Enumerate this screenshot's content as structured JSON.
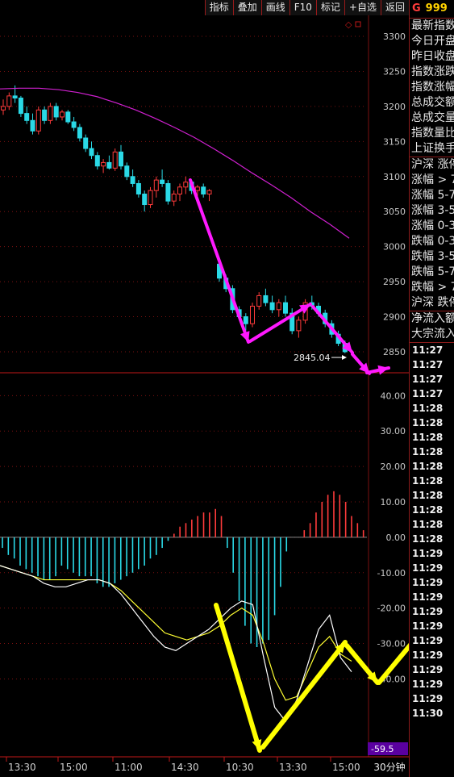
{
  "toolbar": {
    "buttons": [
      "指标",
      "叠加",
      "画线",
      "F10",
      "标记",
      "+自选",
      "返回"
    ]
  },
  "side_panel": {
    "header_g": "G",
    "header_code": "999",
    "rows": [
      "最新指数",
      "今日开盘",
      "昨日收盘",
      "指数涨跌",
      "指数涨幅",
      "总成交额",
      "总成交量",
      "指数量比",
      "上证换手"
    ],
    "breadth_header": "沪深 涨停",
    "breadth_rows": [
      "涨幅 > 7",
      "涨幅 5-7",
      "涨幅 3-5",
      "涨幅 0-3",
      "跌幅 0-3",
      "跌幅 3-5",
      "跌幅 5-7",
      "跌幅 > 7",
      "沪深 跌停"
    ],
    "flow_rows": [
      "净流入额",
      "大宗流入"
    ],
    "times": [
      "11:27",
      "11:27",
      "11:27",
      "11:27",
      "11:28",
      "11:28",
      "11:28",
      "11:28",
      "11:28",
      "11:28",
      "11:28",
      "11:28",
      "11:28",
      "11:28",
      "11:29",
      "11:29",
      "11:29",
      "11:29",
      "11:29",
      "11:29",
      "11:29",
      "11:29",
      "11:29",
      "11:29",
      "11:29",
      "11:30"
    ]
  },
  "timeframe_label": "30分钟",
  "colors": {
    "up": "#ff3b3b",
    "down": "#2ad9e6",
    "ma": "#d020d0",
    "dif": "#ffffff",
    "dea": "#ffff33",
    "grid": "#7a1010",
    "axis_text": "#c8c8c8",
    "arrow_magenta": "#ff19ff",
    "arrow_yellow": "#ffff00",
    "marker_bg": "#5a00a0"
  },
  "chart_data": [
    {
      "type": "candlestick",
      "ylim": [
        2820,
        3330
      ],
      "yticks": [
        2850,
        2900,
        2950,
        3000,
        3050,
        3100,
        3150,
        3200,
        3250,
        3300
      ],
      "candles": [
        [
          3195,
          3210,
          3188,
          3200
        ],
        [
          3200,
          3220,
          3195,
          3215
        ],
        [
          3215,
          3230,
          3205,
          3212
        ],
        [
          3212,
          3215,
          3185,
          3190
        ],
        [
          3190,
          3200,
          3175,
          3180
        ],
        [
          3180,
          3190,
          3160,
          3165
        ],
        [
          3165,
          3200,
          3160,
          3195
        ],
        [
          3195,
          3200,
          3175,
          3180
        ],
        [
          3180,
          3205,
          3175,
          3200
        ],
        [
          3200,
          3205,
          3180,
          3185
        ],
        [
          3185,
          3195,
          3180,
          3192
        ],
        [
          3192,
          3195,
          3175,
          3178
        ],
        [
          3178,
          3185,
          3165,
          3170
        ],
        [
          3170,
          3175,
          3150,
          3155
        ],
        [
          3155,
          3160,
          3135,
          3140
        ],
        [
          3140,
          3150,
          3125,
          3130
        ],
        [
          3130,
          3135,
          3110,
          3115
        ],
        [
          3115,
          3125,
          3105,
          3120
        ],
        [
          3120,
          3130,
          3110,
          3112
        ],
        [
          3112,
          3140,
          3108,
          3135
        ],
        [
          3135,
          3145,
          3110,
          3115
        ],
        [
          3115,
          3120,
          3095,
          3100
        ],
        [
          3100,
          3110,
          3085,
          3090
        ],
        [
          3090,
          3095,
          3070,
          3075
        ],
        [
          3075,
          3080,
          3050,
          3060
        ],
        [
          3060,
          3085,
          3055,
          3080
        ],
        [
          3080,
          3100,
          3070,
          3095
        ],
        [
          3095,
          3110,
          3085,
          3090
        ],
        [
          3090,
          3095,
          3060,
          3065
        ],
        [
          3065,
          3080,
          3058,
          3075
        ],
        [
          3075,
          3090,
          3065,
          3085
        ],
        [
          3085,
          3100,
          3075,
          3092
        ],
        [
          3092,
          3095,
          3075,
          3080
        ],
        [
          3080,
          3088,
          3072,
          3085
        ],
        [
          3085,
          3090,
          3070,
          3075
        ],
        [
          3075,
          3082,
          3065,
          3080
        ],
        [
          2975,
          2980,
          2950,
          2955
        ],
        [
          2955,
          2960,
          2935,
          2940
        ],
        [
          2940,
          2945,
          2905,
          2910
        ],
        [
          2910,
          2915,
          2895,
          2900
        ],
        [
          2900,
          2905,
          2880,
          2890
        ],
        [
          2890,
          2920,
          2885,
          2915
        ],
        [
          2915,
          2935,
          2910,
          2930
        ],
        [
          2930,
          2940,
          2915,
          2920
        ],
        [
          2920,
          2930,
          2905,
          2910
        ],
        [
          2910,
          2925,
          2900,
          2920
        ],
        [
          2920,
          2930,
          2900,
          2905
        ],
        [
          2905,
          2912,
          2875,
          2880
        ],
        [
          2880,
          2900,
          2870,
          2895
        ],
        [
          2895,
          2925,
          2890,
          2920
        ],
        [
          2920,
          2930,
          2910,
          2915
        ],
        [
          2915,
          2920,
          2900,
          2905
        ],
        [
          2905,
          2910,
          2885,
          2890
        ],
        [
          2890,
          2895,
          2870,
          2875
        ],
        [
          2875,
          2880,
          2858,
          2862
        ],
        [
          2862,
          2866,
          2848,
          2850
        ]
      ],
      "ma": [
        3225,
        3226,
        3226,
        3224,
        3220,
        3214,
        3205,
        3195,
        3183,
        3170,
        3156,
        3140,
        3123,
        3105,
        3088,
        3070,
        3050,
        3032,
        3012
      ],
      "annotation": "2845.04"
    },
    {
      "type": "macd",
      "ylim": [
        -62,
        46
      ],
      "yticks": [
        40,
        30,
        20,
        10,
        0,
        -10,
        -20,
        -30,
        -40
      ],
      "hist": [
        -3,
        -5,
        -6,
        -8,
        -9,
        -10,
        -11,
        -12,
        -12,
        -11,
        -8,
        -9,
        -10,
        -11,
        -11,
        -11,
        -13,
        -14,
        -14,
        -13,
        -12,
        -11,
        -10,
        -9,
        -8,
        -6,
        -5,
        -3,
        -1,
        1,
        3,
        4,
        5,
        6,
        7,
        7,
        8,
        6,
        -3,
        -10,
        -18,
        -25,
        -30,
        -31,
        -30,
        -29,
        -22,
        -14,
        -4,
        0,
        0,
        2,
        4,
        7,
        10,
        12,
        13,
        12,
        10,
        6,
        4,
        2
      ],
      "dif": [
        -8,
        -9,
        -10,
        -11,
        -13,
        -14,
        -14,
        -13,
        -12,
        -12,
        -13,
        -16,
        -20,
        -24,
        -28,
        -31,
        -32,
        -30,
        -28,
        -26,
        -23,
        -20,
        -18,
        -19,
        -34,
        -48,
        -52,
        -46,
        -36,
        -26,
        -22,
        -34,
        -38
      ],
      "dea": [
        -8,
        -9,
        -10,
        -11,
        -12,
        -12,
        -12,
        -12,
        -12,
        -12,
        -13,
        -15,
        -18,
        -21,
        -24,
        -27,
        -28,
        -29,
        -28,
        -27,
        -25,
        -22,
        -20,
        -22,
        -30,
        -40,
        -46,
        -45,
        -38,
        -31,
        -28,
        -33,
        -35
      ],
      "marker_value": "-59.5",
      "x_labels": [
        "13:30",
        "15:00",
        "11:00",
        "14:30",
        "10:30",
        "13:30",
        "15:00"
      ]
    }
  ]
}
